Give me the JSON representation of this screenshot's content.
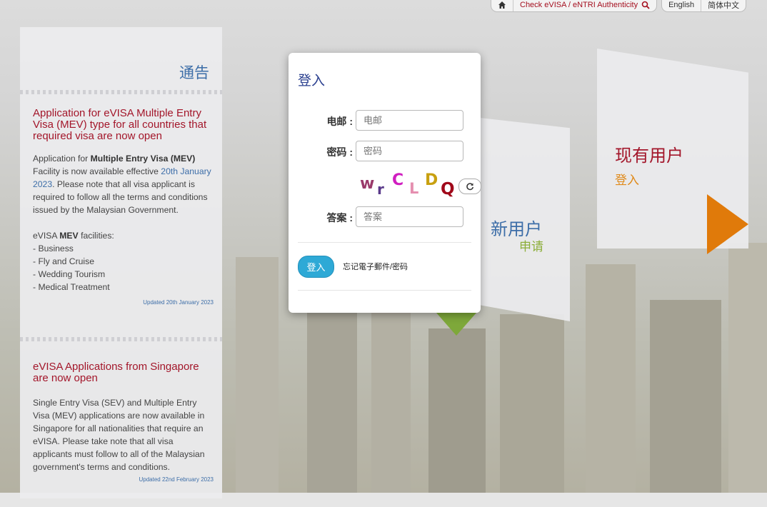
{
  "topbar": {
    "check_link": "Check eVISA / eNTRI Authenticity",
    "lang_en": "English",
    "lang_zh": "简体中文"
  },
  "notice": {
    "title": "通告",
    "items": [
      {
        "heading": "Application for eVISA Multiple Entry Visa (MEV) type for all countries that required visa are now open",
        "p1_a": "Application for ",
        "p1_b": "Multiple Entry Visa (MEV)",
        "p1_c": " Facility is now available effective ",
        "p1_date": "20th January 2023",
        "p1_d": ". Please note that all visa applicant is required to follow all the terms and conditions issued by the Malaysian Government.",
        "fac_a": "eVISA ",
        "fac_b": "MEV",
        "fac_c": " facilities:",
        "list": [
          "- Business",
          "- Fly and Cruise",
          "- Wedding Tourism",
          "- Medical Treatment"
        ],
        "updated": "Updated 20th January 2023"
      },
      {
        "heading": "eVISA Applications from Singapore are now open",
        "body": "Single Entry Visa (SEV) and Multiple Entry Visa (MEV) applications are now available in Singapore for all nationalities that require an eVISA. Please take note that all visa applicants must follow to all of the Malaysian government's terms and conditions.",
        "updated": "Updated 22nd February 2023"
      }
    ]
  },
  "cards": {
    "existing_title": "现有用户",
    "existing_sub": "登入",
    "new_title": "新用户",
    "new_sub": "申请"
  },
  "modal": {
    "title": "登入",
    "email_label": "电邮 :",
    "email_placeholder": "电邮",
    "password_label": "密码 :",
    "password_placeholder": "密码",
    "captcha_chars": [
      "w",
      "r",
      "C",
      "L",
      "D",
      "Q"
    ],
    "answer_label": "答案 :",
    "answer_placeholder": "答案",
    "login_button": "登入",
    "forgot_link": "忘记電子郵件/密码"
  }
}
